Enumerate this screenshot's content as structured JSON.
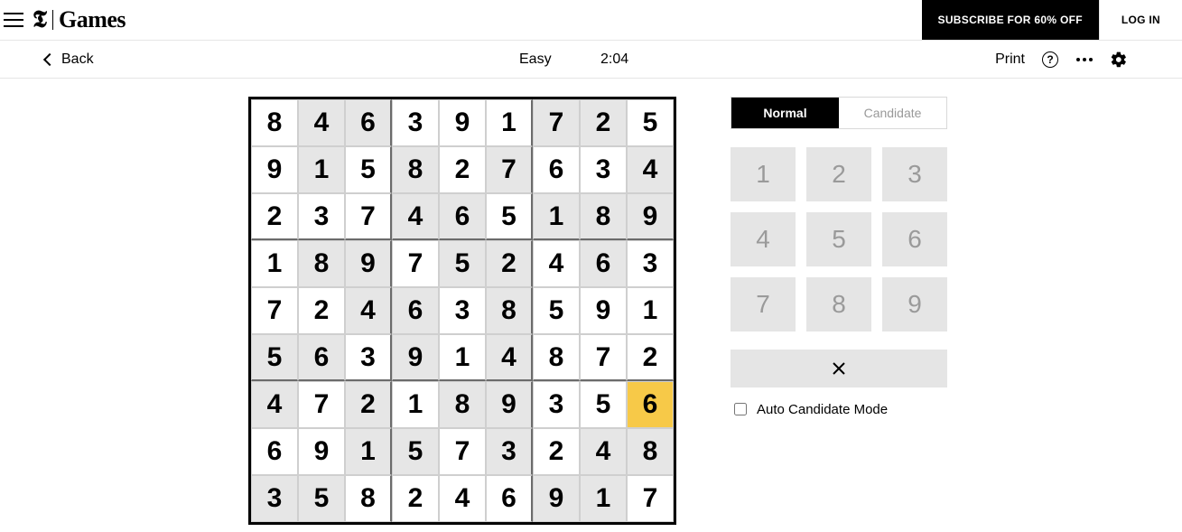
{
  "header": {
    "brand_t": "𝕿",
    "brand_games": "Games",
    "subscribe_label": "SUBSCRIBE FOR 60% OFF",
    "login_label": "LOG IN"
  },
  "subheader": {
    "back_label": "Back",
    "difficulty": "Easy",
    "timer": "2:04",
    "print_label": "Print",
    "help_glyph": "?"
  },
  "board": {
    "cells": [
      [
        {
          "v": "8",
          "p": false
        },
        {
          "v": "4",
          "p": true
        },
        {
          "v": "6",
          "p": true
        },
        {
          "v": "3",
          "p": false
        },
        {
          "v": "9",
          "p": false
        },
        {
          "v": "1",
          "p": false
        },
        {
          "v": "7",
          "p": true
        },
        {
          "v": "2",
          "p": true
        },
        {
          "v": "5",
          "p": false
        }
      ],
      [
        {
          "v": "9",
          "p": false
        },
        {
          "v": "1",
          "p": true
        },
        {
          "v": "5",
          "p": false
        },
        {
          "v": "8",
          "p": true
        },
        {
          "v": "2",
          "p": false
        },
        {
          "v": "7",
          "p": true
        },
        {
          "v": "6",
          "p": false
        },
        {
          "v": "3",
          "p": false
        },
        {
          "v": "4",
          "p": true
        }
      ],
      [
        {
          "v": "2",
          "p": false
        },
        {
          "v": "3",
          "p": false
        },
        {
          "v": "7",
          "p": false
        },
        {
          "v": "4",
          "p": true
        },
        {
          "v": "6",
          "p": true
        },
        {
          "v": "5",
          "p": false
        },
        {
          "v": "1",
          "p": true
        },
        {
          "v": "8",
          "p": true
        },
        {
          "v": "9",
          "p": true
        }
      ],
      [
        {
          "v": "1",
          "p": false
        },
        {
          "v": "8",
          "p": true
        },
        {
          "v": "9",
          "p": true
        },
        {
          "v": "7",
          "p": false
        },
        {
          "v": "5",
          "p": true
        },
        {
          "v": "2",
          "p": true
        },
        {
          "v": "4",
          "p": false
        },
        {
          "v": "6",
          "p": true
        },
        {
          "v": "3",
          "p": false
        }
      ],
      [
        {
          "v": "7",
          "p": false
        },
        {
          "v": "2",
          "p": false
        },
        {
          "v": "4",
          "p": true
        },
        {
          "v": "6",
          "p": true
        },
        {
          "v": "3",
          "p": false
        },
        {
          "v": "8",
          "p": true
        },
        {
          "v": "5",
          "p": false
        },
        {
          "v": "9",
          "p": false
        },
        {
          "v": "1",
          "p": false
        }
      ],
      [
        {
          "v": "5",
          "p": true
        },
        {
          "v": "6",
          "p": true
        },
        {
          "v": "3",
          "p": false
        },
        {
          "v": "9",
          "p": true
        },
        {
          "v": "1",
          "p": false
        },
        {
          "v": "4",
          "p": true
        },
        {
          "v": "8",
          "p": false
        },
        {
          "v": "7",
          "p": false
        },
        {
          "v": "2",
          "p": false
        }
      ],
      [
        {
          "v": "4",
          "p": true
        },
        {
          "v": "7",
          "p": false
        },
        {
          "v": "2",
          "p": true
        },
        {
          "v": "1",
          "p": false
        },
        {
          "v": "8",
          "p": true
        },
        {
          "v": "9",
          "p": true
        },
        {
          "v": "3",
          "p": false
        },
        {
          "v": "5",
          "p": false
        },
        {
          "v": "6",
          "p": false,
          "sel": true
        }
      ],
      [
        {
          "v": "6",
          "p": false
        },
        {
          "v": "9",
          "p": false
        },
        {
          "v": "1",
          "p": true
        },
        {
          "v": "5",
          "p": true
        },
        {
          "v": "7",
          "p": false
        },
        {
          "v": "3",
          "p": true
        },
        {
          "v": "2",
          "p": false
        },
        {
          "v": "4",
          "p": true
        },
        {
          "v": "8",
          "p": true
        }
      ],
      [
        {
          "v": "3",
          "p": true
        },
        {
          "v": "5",
          "p": true
        },
        {
          "v": "8",
          "p": false
        },
        {
          "v": "2",
          "p": false
        },
        {
          "v": "4",
          "p": false
        },
        {
          "v": "6",
          "p": false
        },
        {
          "v": "9",
          "p": true
        },
        {
          "v": "1",
          "p": true
        },
        {
          "v": "7",
          "p": false
        }
      ]
    ]
  },
  "controls": {
    "mode_normal": "Normal",
    "mode_candidate": "Candidate",
    "keys": [
      "1",
      "2",
      "3",
      "4",
      "5",
      "6",
      "7",
      "8",
      "9"
    ],
    "erase_glyph": "✕",
    "auto_label": "Auto Candidate Mode"
  }
}
